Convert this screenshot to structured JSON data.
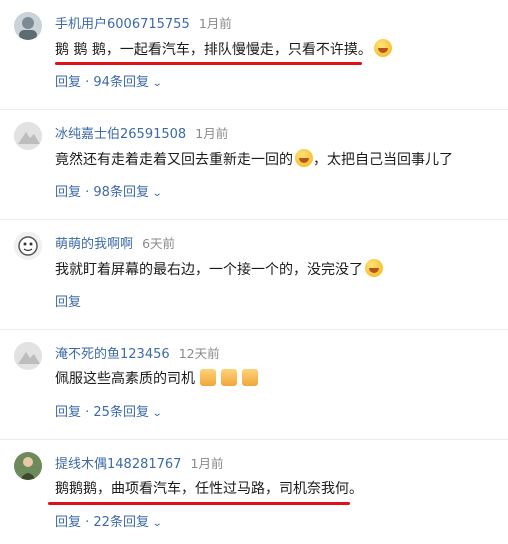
{
  "comments": [
    {
      "username": "手机用户6006715755",
      "time": "1月前",
      "text": "鹅 鹅 鹅，一起看汽车，排队慢慢走，只看不许摸。",
      "emoji": "laugh-emoji",
      "reply_label": "回复 · 94条回复",
      "underlined": true
    },
    {
      "username": "冰纯嘉士伯26591508",
      "time": "1月前",
      "text": "竟然还有走着走着又回去重新走一回的",
      "text_after": "，太把自己当回事儿了",
      "emoji": "laugh-emoji",
      "reply_label": "回复 · 98条回复",
      "underlined": false
    },
    {
      "username": "萌萌的我啊啊",
      "time": "6天前",
      "text": "我就盯着屏幕的最右边，一个接一个的，没完没了",
      "emoji": "laugh-emoji",
      "reply_label": "回复",
      "underlined": false
    },
    {
      "username": "淹不死的鱼123456",
      "time": "12天前",
      "text": "佩服这些高素质的司机",
      "emoji": "thumbs-up-emoji",
      "reply_label": "回复 · 25条回复",
      "underlined": false
    },
    {
      "username": "提线木偶148281767",
      "time": "1月前",
      "text": "鹅鹅鹅，曲项看汽车，任性过马路，司机奈我何。",
      "reply_label": "回复 · 22条回复",
      "underlined": true
    }
  ],
  "colors": {
    "username": "#3d6aa8",
    "time": "#8a8a8a",
    "text": "#1a1a1a",
    "highlight_underline": "#e0101a"
  }
}
